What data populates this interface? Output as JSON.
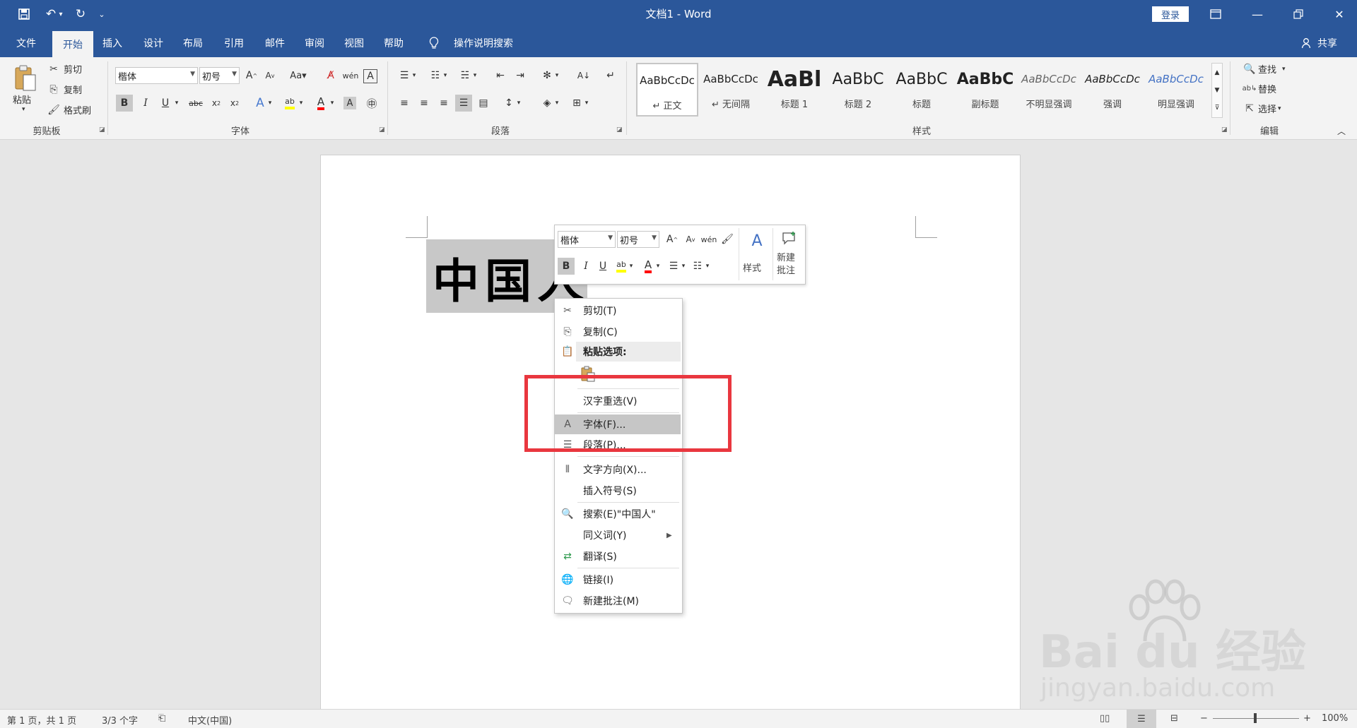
{
  "titlebar": {
    "title": "文档1  -  Word",
    "login": "登录"
  },
  "tabs": [
    "文件",
    "开始",
    "插入",
    "设计",
    "布局",
    "引用",
    "邮件",
    "审阅",
    "视图",
    "帮助"
  ],
  "tell_me": "操作说明搜索",
  "share": "共享",
  "ribbon": {
    "clipboard": {
      "paste": "粘贴",
      "cut": "剪切",
      "copy": "复制",
      "format_painter": "格式刷",
      "label": "剪贴板"
    },
    "font": {
      "font_name": "楷体",
      "font_size": "初号",
      "label": "字体"
    },
    "paragraph": {
      "label": "段落"
    },
    "styles": {
      "label": "样式",
      "items": [
        {
          "preview": "AaBbCcDc",
          "name": "↵ 正文"
        },
        {
          "preview": "AaBbCcDc",
          "name": "↵ 无间隔"
        },
        {
          "preview": "AaBl",
          "name": "标题 1"
        },
        {
          "preview": "AaBbC",
          "name": "标题 2"
        },
        {
          "preview": "AaBbC",
          "name": "标题"
        },
        {
          "preview": "AaBbC",
          "name": "副标题"
        },
        {
          "preview": "AaBbCcDc",
          "name": "不明显强调"
        },
        {
          "preview": "AaBbCcDc",
          "name": "强调"
        },
        {
          "preview": "AaBbCcDc",
          "name": "明显强调"
        }
      ]
    },
    "editing": {
      "find": "查找",
      "replace": "替换",
      "select": "选择",
      "label": "编辑"
    }
  },
  "document": {
    "text": "中国人"
  },
  "minibar": {
    "font_name": "楷体",
    "font_size": "初号",
    "styles": "样式",
    "new_comment_1": "新建",
    "new_comment_2": "批注"
  },
  "context_menu": {
    "items": [
      {
        "label": "剪切(T)"
      },
      {
        "label": "复制(C)"
      },
      {
        "label": "粘贴选项:"
      },
      {
        "label": "汉字重选(V)"
      },
      {
        "label": "字体(F)..."
      },
      {
        "label": "段落(P)..."
      },
      {
        "label": "文字方向(X)..."
      },
      {
        "label": "插入符号(S)"
      },
      {
        "label": "搜索(E)\"中国人\""
      },
      {
        "label": "同义词(Y)"
      },
      {
        "label": "翻译(S)"
      },
      {
        "label": "链接(I)"
      },
      {
        "label": "新建批注(M)"
      }
    ]
  },
  "statusbar": {
    "page": "第 1 页，共 1 页",
    "words": "3/3 个字",
    "language": "中文(中国)",
    "zoom": "100%"
  },
  "watermark": {
    "brand": "Bai du 经验",
    "url": "jingyan.baidu.com"
  },
  "colors": {
    "titlebar": "#2b579a",
    "highlight_box": "#e9373f",
    "font_color": "#ff0000",
    "highlighter": "#ffff00"
  }
}
